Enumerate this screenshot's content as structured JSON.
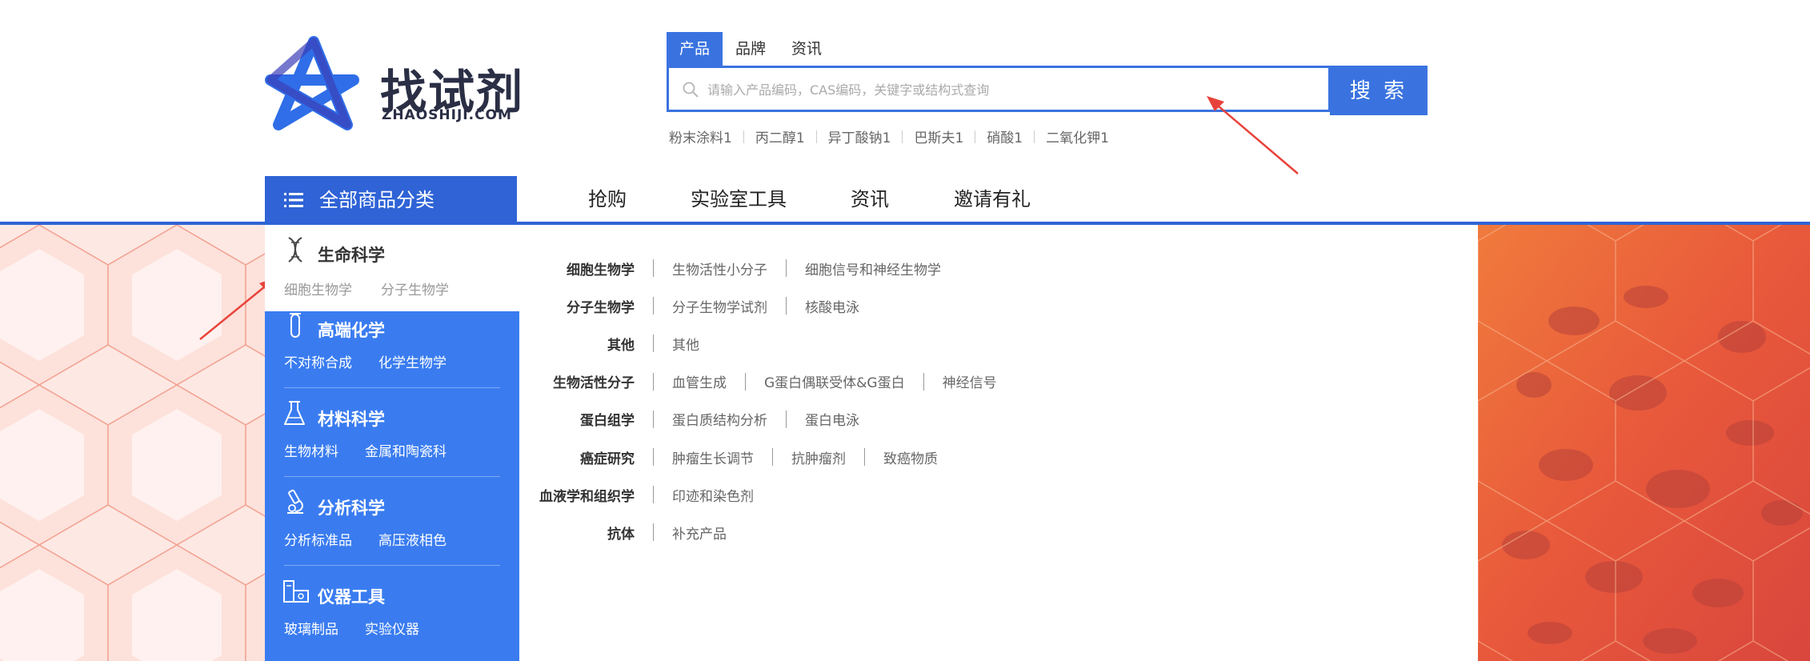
{
  "logo": {
    "name": "找试剂",
    "domain": "ZHAOSHIJI.COM"
  },
  "search": {
    "tabs": [
      "产品",
      "品牌",
      "资讯"
    ],
    "active_tab": 0,
    "placeholder": "请输入产品编码，CAS编码，关键字或结构式查询",
    "button_label": "搜 索",
    "hot_words": [
      "粉末涂料1",
      "丙二醇1",
      "异丁酸钠1",
      "巴斯夫1",
      "硝酸1",
      "二氧化钾1"
    ]
  },
  "nav": {
    "all_categories": "全部商品分类",
    "items": [
      "抢购",
      "实验室工具",
      "资讯",
      "邀请有礼"
    ]
  },
  "sidebar": {
    "categories": [
      {
        "title": "生命科学",
        "icon": "dna-icon",
        "subs": [
          "细胞生物学",
          "分子生物学"
        ]
      },
      {
        "title": "高端化学",
        "icon": "test-tube-icon",
        "subs": [
          "不对称合成",
          "化学生物学"
        ]
      },
      {
        "title": "材料科学",
        "icon": "flask-icon",
        "subs": [
          "生物材料",
          "金属和陶瓷科"
        ]
      },
      {
        "title": "分析科学",
        "icon": "microscope-icon",
        "subs": [
          "分析标准品",
          "高压液相色"
        ]
      },
      {
        "title": "仪器工具",
        "icon": "instrument-icon",
        "subs": [
          "玻璃制品",
          "实验仪器"
        ]
      }
    ]
  },
  "content": {
    "rows": [
      {
        "label": "细胞生物学",
        "items": [
          "生物活性小分子",
          "细胞信号和神经生物学"
        ]
      },
      {
        "label": "分子生物学",
        "items": [
          "分子生物学试剂",
          "核酸电泳"
        ]
      },
      {
        "label": "其他",
        "items": [
          "其他"
        ]
      },
      {
        "label": "生物活性分子",
        "items": [
          "血管生成",
          "G蛋白偶联受体&G蛋白",
          "神经信号"
        ]
      },
      {
        "label": "蛋白组学",
        "items": [
          "蛋白质结构分析",
          "蛋白电泳"
        ]
      },
      {
        "label": "癌症研究",
        "items": [
          "肿瘤生长调节",
          "抗肿瘤剂",
          "致癌物质"
        ]
      },
      {
        "label": "血液学和组织学",
        "items": [
          "印迹和染色剂"
        ]
      },
      {
        "label": "抗体",
        "items": [
          "补充产品"
        ]
      }
    ]
  },
  "colors": {
    "primary": "#3a73e0",
    "nav_blue": "#2f63d6",
    "sidebar_blue": "#3a7cf0",
    "arrow": "#e8433a"
  }
}
